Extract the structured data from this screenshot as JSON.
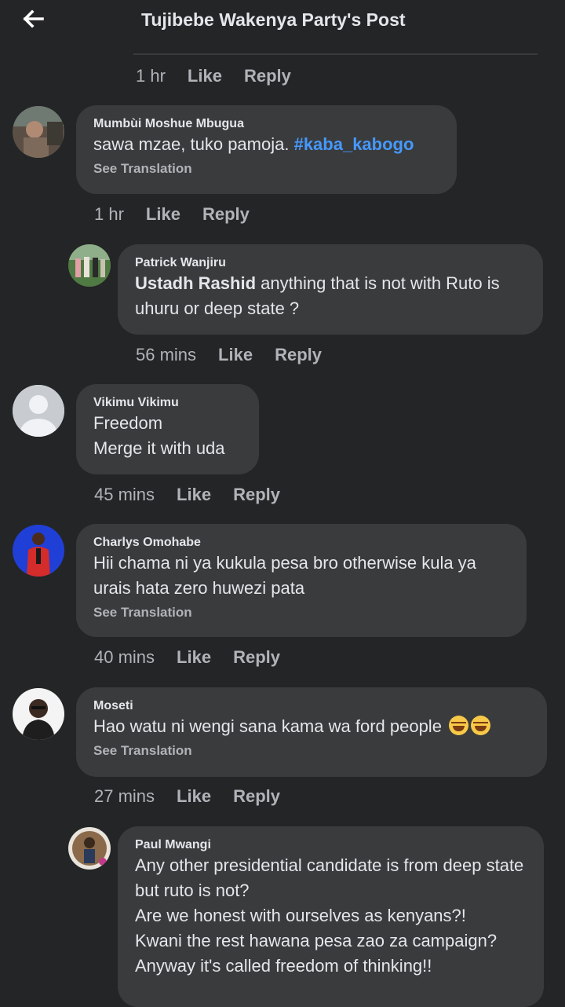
{
  "header": {
    "title": "Tujibebe Wakenya Party's Post"
  },
  "actions": {
    "like": "Like",
    "reply": "Reply"
  },
  "top_meta": {
    "time": "1 hr"
  },
  "comments": [
    {
      "name": "Mumbùi Moshue Mbugua",
      "text": "sawa mzae, tuko pamoja. ",
      "hashtag": "#kaba_kabogo",
      "see_translation": "See Translation",
      "time": "1 hr"
    },
    {
      "name": "Patrick Wanjiru",
      "mention": "Ustadh Rashid",
      "text": " anything that is not with Ruto is uhuru or deep state ?",
      "time": "56 mins"
    },
    {
      "name": "Vikimu Vikimu",
      "text": "Freedom\nMerge it with uda",
      "time": "45 mins"
    },
    {
      "name": "Charlys Omohabe",
      "text": "Hii chama ni ya kukula pesa bro otherwise kula ya urais hata zero huwezi pata",
      "see_translation": "See Translation",
      "time": "40 mins"
    },
    {
      "name": "Moseti",
      "text": "Hao watu ni wengi sana kama wa ford people ",
      "see_translation": "See Translation",
      "time": "27 mins"
    },
    {
      "name": "Paul Mwangi",
      "text": "Any other presidential candidate is from deep state but ruto is not?\nAre we honest with ourselves as kenyans?!\nKwani the rest hawana pesa zao za campaign?\nAnyway it's called freedom of thinking!!"
    }
  ],
  "icons": {
    "back": "arrow-left-icon",
    "emoji": "tears-of-joy-emoji"
  },
  "colors": {
    "background": "#242526",
    "bubble": "#3a3b3c",
    "hashtag": "#4599ff",
    "muted": "#b0b3b8"
  }
}
